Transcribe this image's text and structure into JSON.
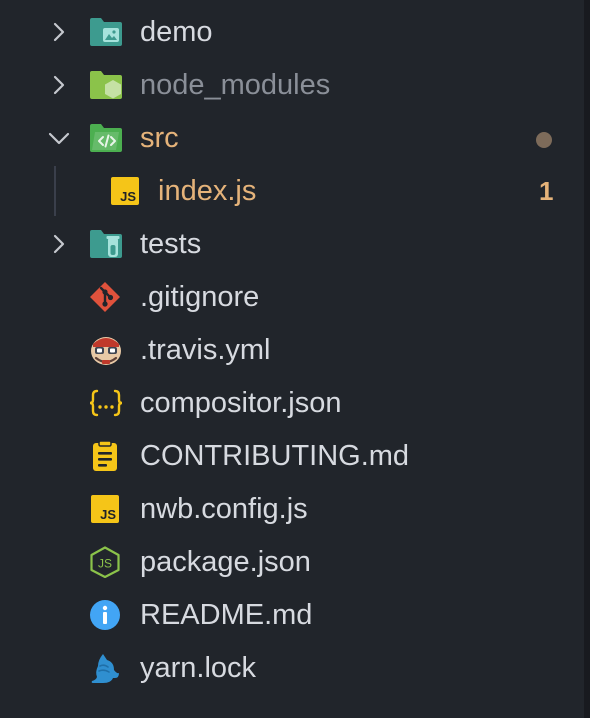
{
  "explorer": {
    "items": [
      {
        "label": "demo",
        "type": "folder",
        "icon": "folder-images-icon",
        "collapsed": true
      },
      {
        "label": "node_modules",
        "type": "folder",
        "icon": "folder-node-icon",
        "collapsed": true,
        "dimmed": true
      },
      {
        "label": "src",
        "type": "folder",
        "icon": "folder-src-icon",
        "collapsed": false,
        "modified": true
      },
      {
        "label": "index.js",
        "type": "file",
        "icon": "javascript-icon",
        "problems": "1"
      },
      {
        "label": "tests",
        "type": "folder",
        "icon": "folder-test-icon",
        "collapsed": true
      },
      {
        "label": ".gitignore",
        "type": "file",
        "icon": "git-icon"
      },
      {
        "label": ".travis.yml",
        "type": "file",
        "icon": "travis-icon"
      },
      {
        "label": "compositor.json",
        "type": "file",
        "icon": "json-icon"
      },
      {
        "label": "CONTRIBUTING.md",
        "type": "file",
        "icon": "contributing-icon"
      },
      {
        "label": "nwb.config.js",
        "type": "file",
        "icon": "javascript-icon"
      },
      {
        "label": "package.json",
        "type": "file",
        "icon": "nodejs-icon"
      },
      {
        "label": "README.md",
        "type": "file",
        "icon": "info-icon"
      },
      {
        "label": "yarn.lock",
        "type": "file",
        "icon": "yarn-icon"
      }
    ]
  },
  "colors": {
    "background": "#21252b",
    "text": "#d7dae0",
    "dimmed_text": "#8a8f98",
    "modified": "#e5b37a",
    "modified_dot": "#7d6b5a",
    "folder_teal": "#3d9b8f",
    "folder_green": "#8bc34a",
    "js_yellow": "#f5c518"
  }
}
